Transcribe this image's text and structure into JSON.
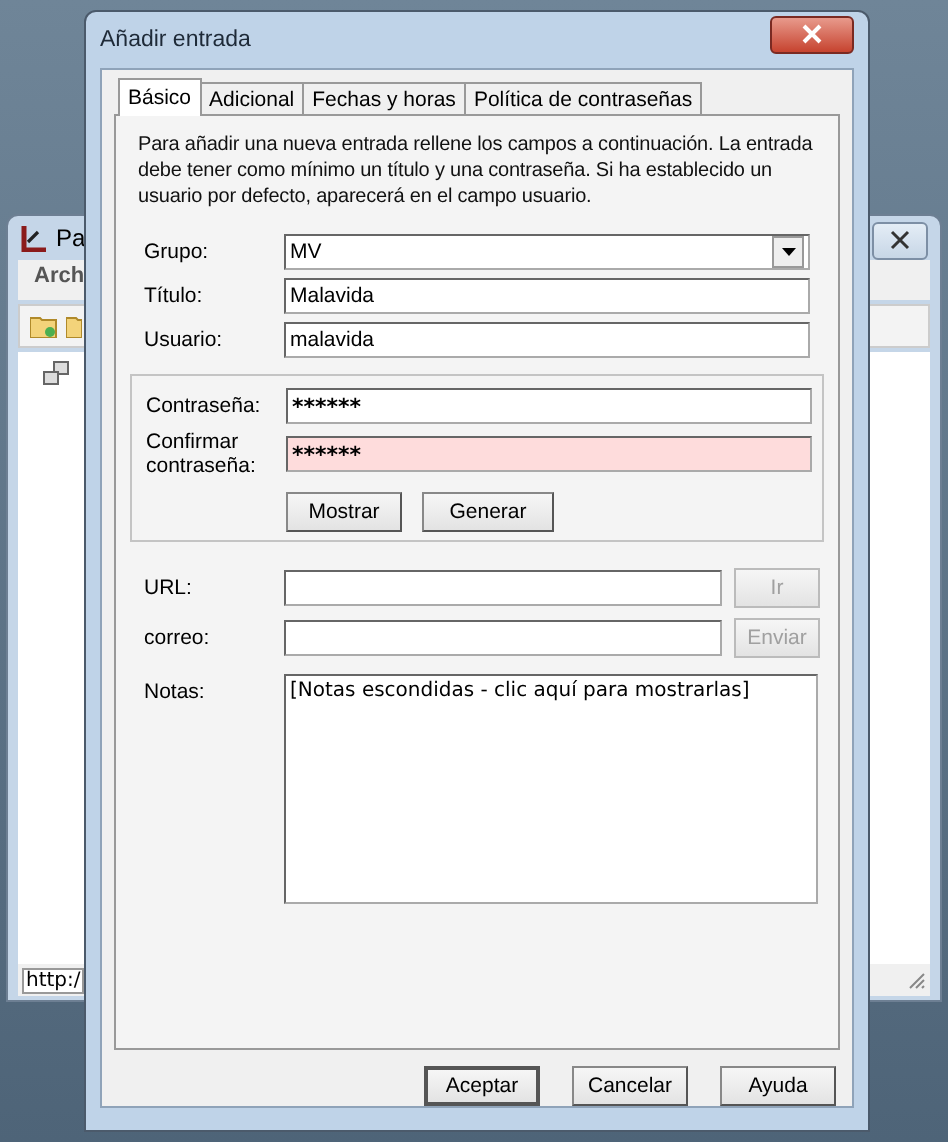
{
  "background_window": {
    "title": "Pa",
    "menu": [
      "Arch"
    ],
    "status": "http:/"
  },
  "dialog": {
    "title": "Añadir entrada",
    "tabs": [
      {
        "label": "Básico",
        "selected": true
      },
      {
        "label": "Adicional",
        "selected": false
      },
      {
        "label": "Fechas y horas",
        "selected": false
      },
      {
        "label": "Política de contraseñas",
        "selected": false
      }
    ],
    "intro": "Para añadir una nueva entrada rellene los campos a continuación. La entrada debe tener como mínimo un título y una contraseña. Si ha establecido un usuario por defecto, aparecerá en el campo usuario.",
    "fields": [
      {
        "kind": "select",
        "label": "Grupo:",
        "value": "MV"
      },
      {
        "kind": "text",
        "label": "Título:",
        "value": "Malavida"
      },
      {
        "kind": "text",
        "label": "Usuario:",
        "value": "malavida"
      }
    ],
    "password": {
      "fields": [
        {
          "label": "Contraseña:",
          "value": "******",
          "mismatch": false
        },
        {
          "label": "Confirmar contraseña:",
          "value": "******",
          "mismatch": true
        }
      ],
      "buttons": [
        "Mostrar",
        "Generar"
      ]
    },
    "links": [
      {
        "label": "URL:",
        "button": {
          "label": "Ir",
          "disabled": true
        }
      },
      {
        "label": "correo:",
        "button": {
          "label": "Enviar",
          "disabled": true
        }
      }
    ],
    "notes": {
      "label": "Notas:",
      "value": "[Notas escondidas - clic aquí para mostrarlas]"
    },
    "buttons": [
      {
        "label": "Aceptar",
        "default": true
      },
      {
        "label": "Cancelar",
        "default": false
      },
      {
        "label": "Ayuda",
        "default": false
      }
    ]
  }
}
